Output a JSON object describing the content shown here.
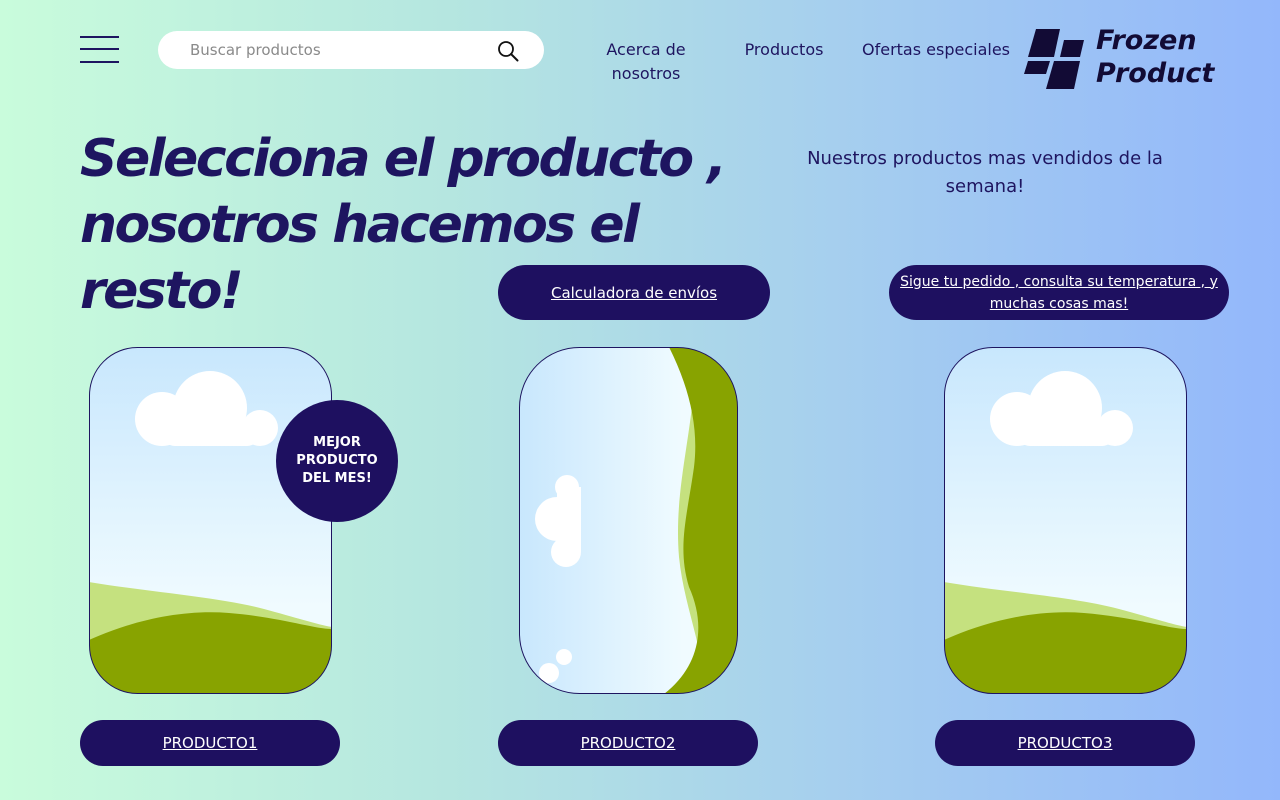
{
  "header": {
    "search_placeholder": "Buscar productos",
    "nav": {
      "about": "Acerca de nosotros",
      "products": "Productos",
      "offers": "Ofertas especiales"
    },
    "logo_line1": "Frozen",
    "logo_line2": "Product"
  },
  "hero": {
    "headline": "Selecciona el producto , nosotros hacemos el resto!",
    "subtitle": "Nuestros productos mas vendidos de la semana!"
  },
  "actions": {
    "calculator": "Calculadora de envíos",
    "tracking": "Sigue tu pedido , consulta su temperatura , y muchas cosas mas!"
  },
  "badge": "MEJOR PRODUCTO DEL MES!",
  "products": [
    {
      "label": "PRODUCTO1",
      "image_icon": "landscape-image-placeholder-icon"
    },
    {
      "label": "PRODUCTO2",
      "image_icon": "landscape-image-placeholder-icon"
    },
    {
      "label": "PRODUCTO3",
      "image_icon": "landscape-image-placeholder-icon"
    }
  ],
  "icons": {
    "menu": "hamburger-menu-icon",
    "search": "search-icon",
    "logo": "frozen-product-logo-icon"
  },
  "colors": {
    "primary": "#1e1060",
    "text": "#1e1560",
    "gradient_start": "#c9fcdc",
    "gradient_end": "#93b7fb",
    "grass_dark": "#88a300",
    "grass_light": "#c5e17f"
  }
}
